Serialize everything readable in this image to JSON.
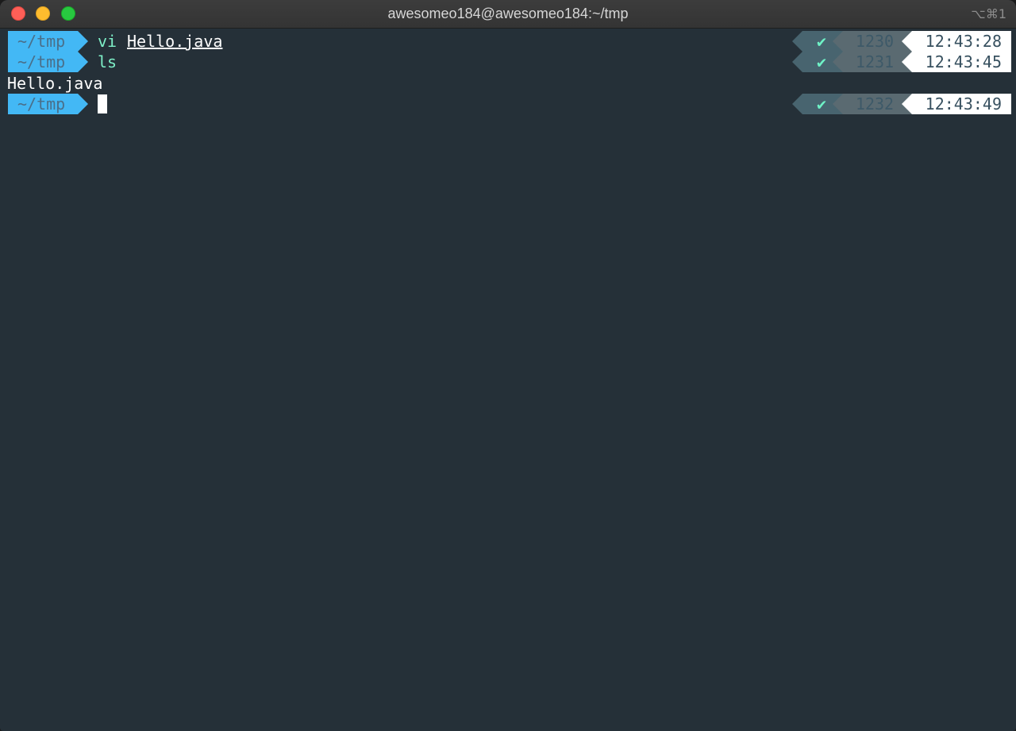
{
  "window": {
    "title": "awesomeo184@awesomeo184:~/tmp",
    "shortcut": "⌥⌘1"
  },
  "terminal": {
    "lines": [
      {
        "dir": "~/tmp",
        "cmd": "vi",
        "arg": "Hello.java",
        "status": "✔",
        "history": "1230",
        "time": "12:43:28"
      },
      {
        "dir": "~/tmp",
        "cmd": "ls",
        "arg": "",
        "status": "✔",
        "history": "1231",
        "time": "12:43:45"
      },
      {
        "output": "Hello.java"
      },
      {
        "dir": "~/tmp",
        "cmd": "",
        "arg": "",
        "status": "✔",
        "history": "1232",
        "time": "12:43:49"
      }
    ]
  },
  "colors": {
    "background": "#253038",
    "dir_segment": "#43b8f5",
    "command": "#7ef0c8",
    "time_segment": "#ffffff"
  }
}
